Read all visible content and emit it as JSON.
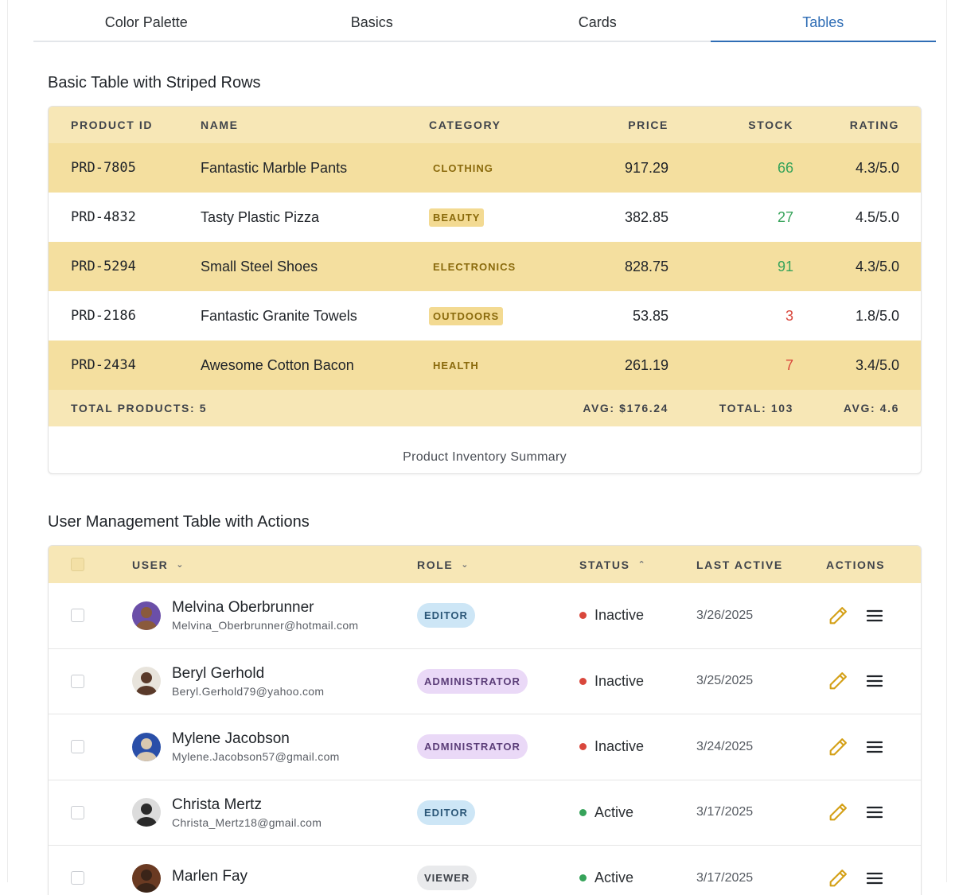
{
  "tabs": [
    "Color Palette",
    "Basics",
    "Cards",
    "Tables"
  ],
  "active_tab": "Tables",
  "products": {
    "title": "Basic Table with Striped Rows",
    "headers": {
      "id": "PRODUCT ID",
      "name": "NAME",
      "category": "CATEGORY",
      "price": "PRICE",
      "stock": "STOCK",
      "rating": "RATING"
    },
    "rows": [
      {
        "id": "PRD-7805",
        "name": "Fantastic Marble Pants",
        "category": "CLOTHING",
        "price": "917.29",
        "stock": "66",
        "rating": "4.3/5.0"
      },
      {
        "id": "PRD-4832",
        "name": "Tasty Plastic Pizza",
        "category": "BEAUTY",
        "price": "382.85",
        "stock": "27",
        "rating": "4.5/5.0"
      },
      {
        "id": "PRD-5294",
        "name": "Small Steel Shoes",
        "category": "ELECTRONICS",
        "price": "828.75",
        "stock": "91",
        "rating": "4.3/5.0"
      },
      {
        "id": "PRD-2186",
        "name": "Fantastic Granite Towels",
        "category": "OUTDOORS",
        "price": "53.85",
        "stock": "3",
        "rating": "1.8/5.0"
      },
      {
        "id": "PRD-2434",
        "name": "Awesome Cotton Bacon",
        "category": "HEALTH",
        "price": "261.19",
        "stock": "7",
        "rating": "3.4/5.0"
      }
    ],
    "footer": {
      "total_products": "TOTAL PRODUCTS: 5",
      "avg_price": "AVG: $176.24",
      "total_stock": "TOTAL: 103",
      "avg_rating": "AVG: 4.6"
    },
    "caption": "Product Inventory Summary"
  },
  "users": {
    "title": "User Management Table with Actions",
    "headers": {
      "user": "USER",
      "role": "ROLE",
      "status": "STATUS",
      "last_active": "LAST ACTIVE",
      "actions": "ACTIONS"
    },
    "rows": [
      {
        "name": "Melvina Oberbrunner",
        "email": "Melvina_Oberbrunner@hotmail.com",
        "role": "EDITOR",
        "status": "Inactive",
        "last_active": "3/26/2025"
      },
      {
        "name": "Beryl Gerhold",
        "email": "Beryl.Gerhold79@yahoo.com",
        "role": "ADMINISTRATOR",
        "status": "Inactive",
        "last_active": "3/25/2025"
      },
      {
        "name": "Mylene Jacobson",
        "email": "Mylene.Jacobson57@gmail.com",
        "role": "ADMINISTRATOR",
        "status": "Inactive",
        "last_active": "3/24/2025"
      },
      {
        "name": "Christa Mertz",
        "email": "Christa_Mertz18@gmail.com",
        "role": "EDITOR",
        "status": "Active",
        "last_active": "3/17/2025"
      },
      {
        "name": "Marlen Fay",
        "email": "",
        "role": "VIEWER",
        "status": "Active",
        "last_active": "3/17/2025"
      }
    ]
  },
  "colors": {
    "accent": "#2f6db5",
    "header_bg": "#f7e7b6",
    "stripe": "#f4df9f",
    "active": "#36a35a",
    "inactive": "#d9473c",
    "edit_icon": "#d4a017"
  }
}
